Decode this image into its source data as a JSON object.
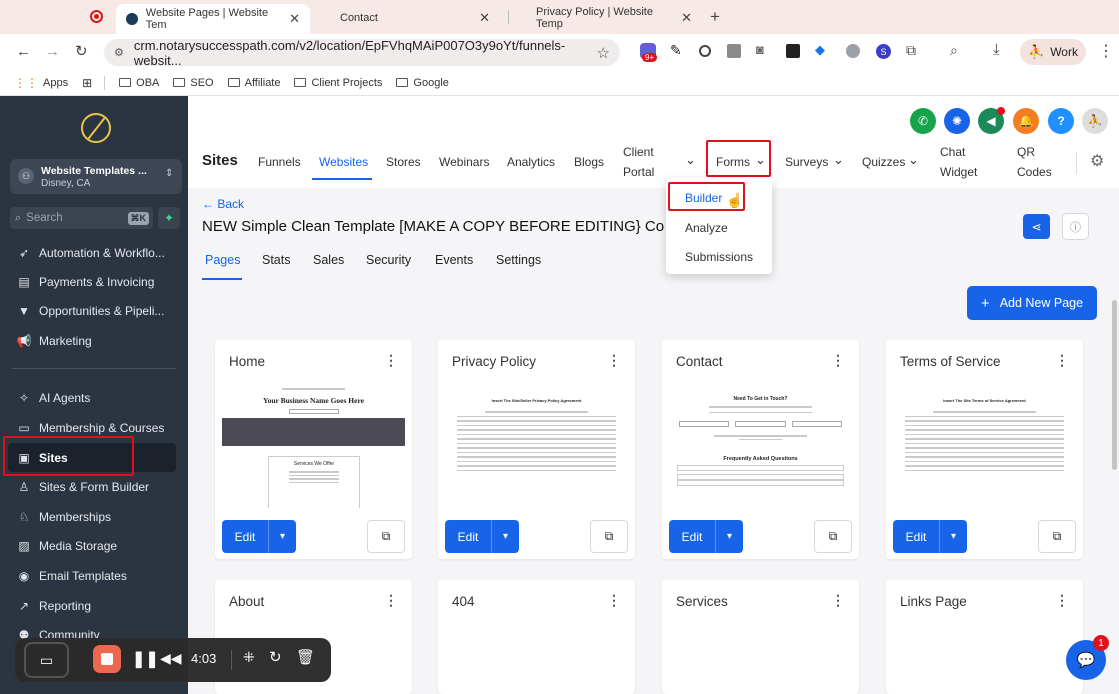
{
  "browser": {
    "tabs": [
      {
        "label": "Website Pages | Website Tem"
      },
      {
        "label": "Contact"
      },
      {
        "label": "Privacy Policy | Website Temp"
      }
    ],
    "url": "crm.notarysuccesspath.com/v2/location/EpFVhqMAiP007O3y9oYt/funnels-websit...",
    "profile_label": "Work",
    "ext_badge": "9+",
    "bookmarks": [
      "Apps",
      "OBA",
      "SEO",
      "Affiliate",
      "Client Projects",
      "Google"
    ]
  },
  "sidebar": {
    "account_name": "Website Templates ...",
    "account_location": "Disney, CA",
    "search_placeholder": "Search",
    "search_shortcut": "⌘K",
    "items": [
      {
        "label": "Automation & Workflo..."
      },
      {
        "label": "Payments & Invoicing"
      },
      {
        "label": "Opportunities & Pipeli..."
      },
      {
        "label": "Marketing"
      },
      {
        "label": "AI Agents"
      },
      {
        "label": "Membership & Courses"
      },
      {
        "label": "Sites"
      },
      {
        "label": "Sites & Form Builder"
      },
      {
        "label": "Memberships"
      },
      {
        "label": "Media Storage"
      },
      {
        "label": "Email Templates"
      },
      {
        "label": "Reporting"
      },
      {
        "label": "Community"
      }
    ]
  },
  "topnav": {
    "title": "Sites",
    "items": [
      "Funnels",
      "Websites",
      "Stores",
      "Webinars",
      "Analytics",
      "Blogs"
    ],
    "client_portal_1": "Client",
    "client_portal_2": "Portal",
    "forms": "Forms",
    "surveys": "Surveys",
    "quizzes": "Quizzes",
    "chat_1": "Chat",
    "chat_2": "Widget",
    "qr_1": "QR",
    "qr_2": "Codes"
  },
  "forms_menu": [
    "Builder",
    "Analyze",
    "Submissions"
  ],
  "page": {
    "back": "← Back",
    "title": "NEW Simple Clean Template [MAKE A COPY BEFORE EDITING} Co",
    "tabs": [
      "Pages",
      "Stats",
      "Sales",
      "Security",
      "Events",
      "Settings"
    ],
    "add_page": "Add New Page"
  },
  "cards": [
    {
      "title": "Home",
      "edit": "Edit"
    },
    {
      "title": "Privacy Policy",
      "edit": "Edit"
    },
    {
      "title": "Contact",
      "edit": "Edit"
    },
    {
      "title": "Terms of Service",
      "edit": "Edit"
    },
    {
      "title": "About"
    },
    {
      "title": "404"
    },
    {
      "title": "Services"
    },
    {
      "title": "Links Page"
    }
  ],
  "thumbs": {
    "home_heading": "Your Business Name Goes Here",
    "home_services": "Services We Offer",
    "privacy_heading": "Insert The Site/Seller Privacy Policy Agreement",
    "contact_heading": "Need To Get in Touch?",
    "contact_faq": "Frequently Asked Questions",
    "terms_heading": "Insert The Site Terms of Service Agreement"
  },
  "recorder": {
    "time": "4:03"
  },
  "chat_badge": "1"
}
